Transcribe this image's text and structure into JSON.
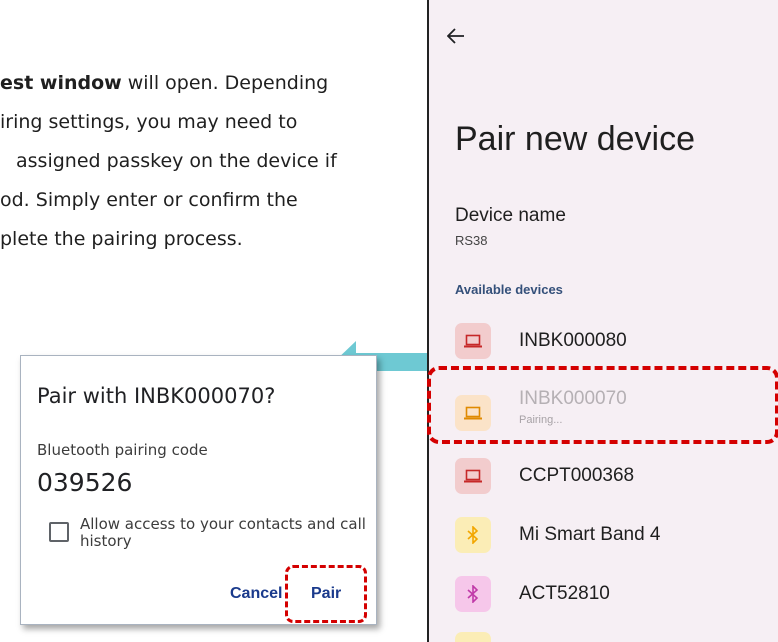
{
  "manual": {
    "line1_bold": "est window",
    "line1_rest": " will open. Depending",
    "line2": "iring settings, you may need to",
    "line3": "assigned passkey on the device if",
    "line4": "od. Simply enter or confirm the",
    "line5": "plete the pairing process."
  },
  "dialog": {
    "title": "Pair with INBK000070?",
    "code_label": "Bluetooth pairing code",
    "code": "039526",
    "checkbox_label": "Allow access to your contacts and call history",
    "checkbox_checked": false,
    "cancel_label": "Cancel",
    "pair_label": "Pair"
  },
  "phone": {
    "title": "Pair new device",
    "device_name_label": "Device name",
    "device_name_value": "RS38",
    "section_label": "Available devices",
    "devices": [
      {
        "name": "INBK000080",
        "icon": "laptop-icon",
        "icon_bg": "#f2cccd",
        "icon_color": "#c62828",
        "status": ""
      },
      {
        "name": "INBK000070",
        "icon": "laptop-icon",
        "icon_bg": "#fbe3c8",
        "icon_color": "#e08a00",
        "status": "Pairing..."
      },
      {
        "name": "CCPT000368",
        "icon": "laptop-icon",
        "icon_bg": "#f2cccd",
        "icon_color": "#c62828",
        "status": ""
      },
      {
        "name": "Mi Smart Band 4",
        "icon": "bluetooth-icon",
        "icon_bg": "#fbedb6",
        "icon_color": "#f2a600",
        "status": ""
      },
      {
        "name": "ACT52810",
        "icon": "bluetooth-icon",
        "icon_bg": "#f6c7ea",
        "icon_color": "#c03aa8",
        "status": ""
      }
    ]
  },
  "colors": {
    "highlight_red": "#d40000",
    "arrow_teal": "#6ec9d3",
    "link_blue": "#1a3a8c"
  }
}
